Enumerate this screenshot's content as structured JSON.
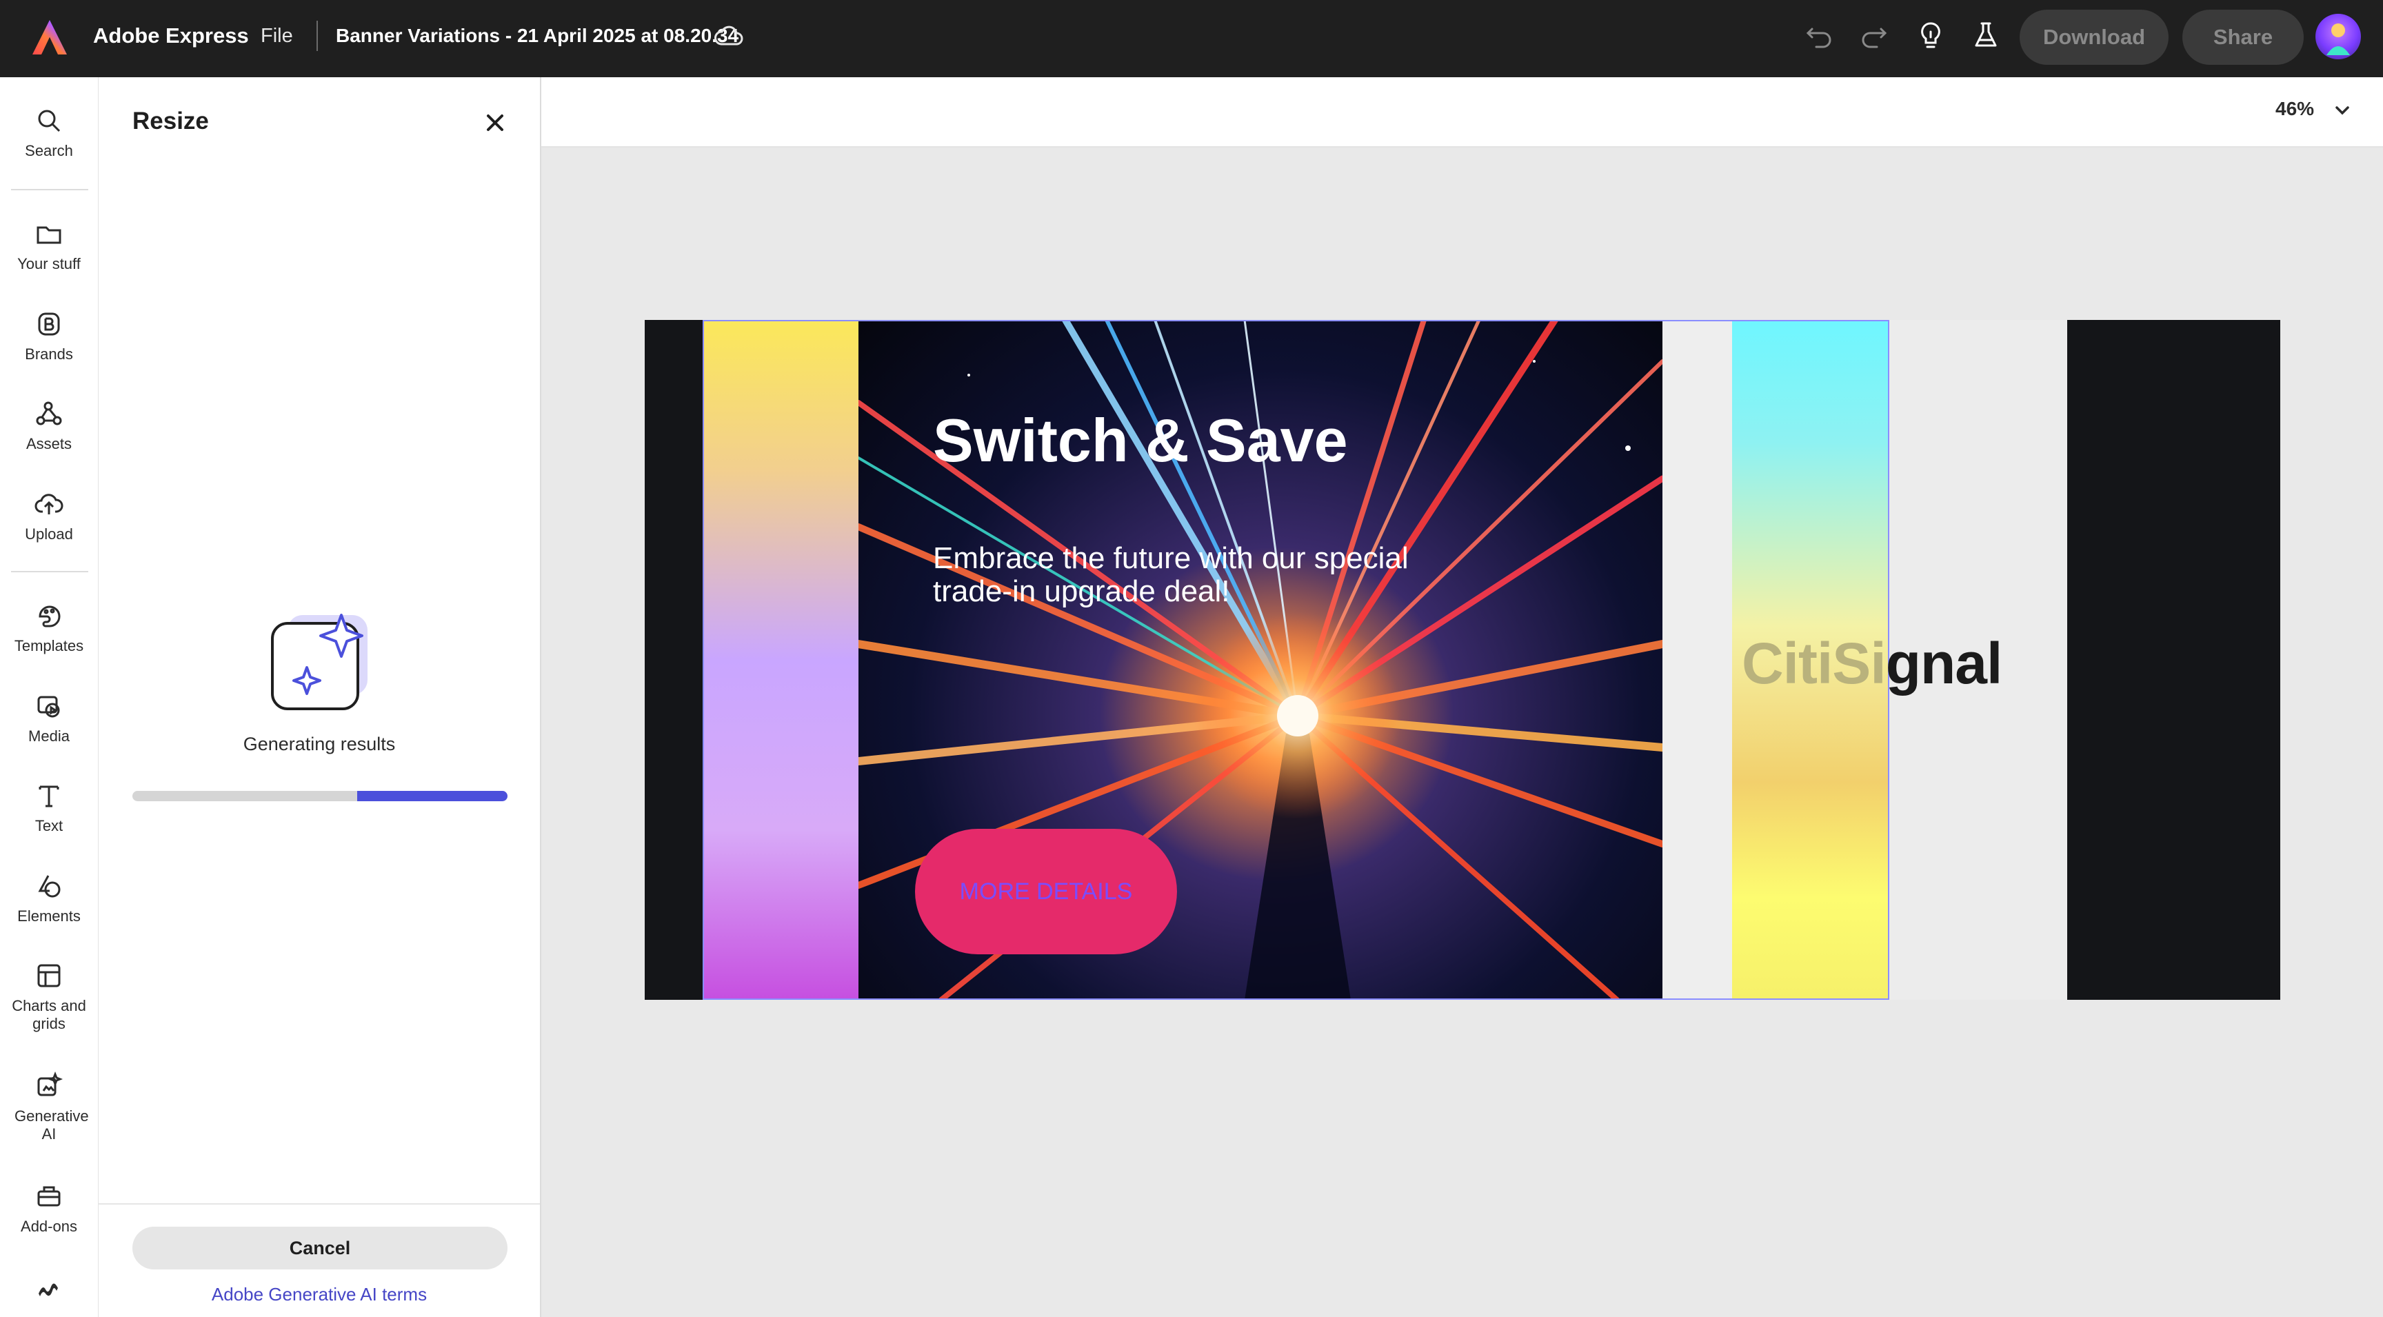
{
  "topbar": {
    "app_name": "Adobe Express",
    "file_menu": "File",
    "doc_title": "Banner Variations - 21 April 2025 at 08.20.34",
    "download_label": "Download",
    "share_label": "Share"
  },
  "rail": {
    "items": [
      {
        "label": "Search",
        "icon": "search-icon"
      },
      {
        "label": "Your stuff",
        "icon": "folder-icon"
      },
      {
        "label": "Brands",
        "icon": "brand-icon"
      },
      {
        "label": "Assets",
        "icon": "assets-icon"
      },
      {
        "label": "Upload",
        "icon": "upload-icon"
      },
      {
        "label": "Templates",
        "icon": "templates-icon"
      },
      {
        "label": "Media",
        "icon": "media-icon"
      },
      {
        "label": "Text",
        "icon": "text-icon"
      },
      {
        "label": "Elements",
        "icon": "elements-icon"
      },
      {
        "label": "Charts and grids",
        "icon": "charts-icon"
      },
      {
        "label": "Generative AI",
        "icon": "generative-ai-icon"
      },
      {
        "label": "Add-ons",
        "icon": "addons-icon"
      }
    ]
  },
  "panel": {
    "title": "Resize",
    "status_text": "Generating results",
    "progress": 0.4,
    "cancel_label": "Cancel",
    "terms_link": "Adobe Generative AI terms"
  },
  "canvas": {
    "zoom": "46%"
  },
  "banner": {
    "headline": "Switch & Save",
    "subtext": "Embrace the future with our special trade-in upgrade deal!",
    "cta_label": "MORE DETAILS",
    "brand_faded": "CitiSi",
    "brand_rest": "gnal"
  },
  "colors": {
    "accent": "#4b50db",
    "cta": "#e52a6a",
    "topbar": "#1f1f1f"
  }
}
